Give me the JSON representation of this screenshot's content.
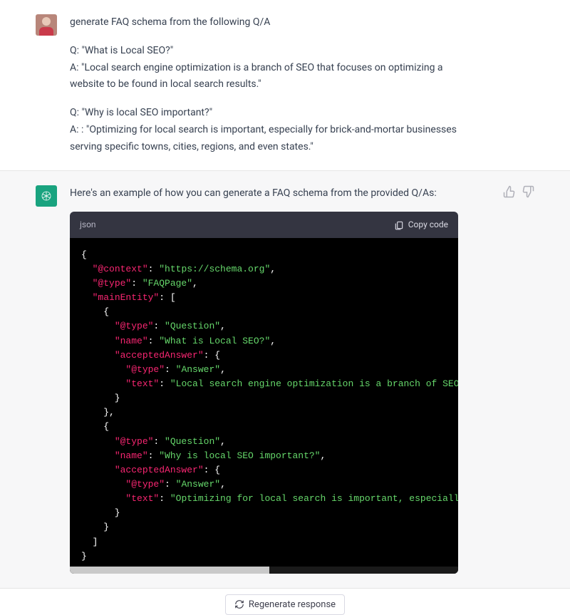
{
  "user_message": {
    "p1": "generate FAQ schema from the following Q/A",
    "p2": "Q: \"What is Local SEO?\"\nA: \"Local search engine optimization is a branch of SEO that focuses on optimizing a website to be found in local search results.\"",
    "p3": "Q: \"Why is local SEO important?\"\nA: : \"Optimizing for local search is important, especially for brick-and-mortar businesses serving specific towns, cities, regions, and even states.\""
  },
  "assistant_message": {
    "intro": "Here's an example of how you can generate a FAQ schema from the provided Q/As:"
  },
  "code": {
    "lang": "json",
    "copy_label": "Copy code",
    "tokens": {
      "t0": "{",
      "k1": "\"@context\"",
      "s1": "\"https://schema.org\"",
      "k2": "\"@type\"",
      "s2": "\"FAQPage\"",
      "k3": "\"mainEntity\"",
      "p3": ": [",
      "t4": "    {",
      "k5": "\"@type\"",
      "s5": "\"Question\"",
      "k6": "\"name\"",
      "s6": "\"What is Local SEO?\"",
      "k7": "\"acceptedAnswer\"",
      "p7": ": {",
      "k8": "\"@type\"",
      "s8": "\"Answer\"",
      "k9": "\"text\"",
      "s9": "\"Local search engine optimization is a branch of SEO that focuses o",
      "t10": "      }",
      "t11": "    },",
      "t12": "    {",
      "k13": "\"@type\"",
      "s13": "\"Question\"",
      "k14": "\"name\"",
      "s14": "\"Why is local SEO important?\"",
      "k15": "\"acceptedAnswer\"",
      "p15": ": {",
      "k16": "\"@type\"",
      "s16": "\"Answer\"",
      "k17": "\"text\"",
      "s17": "\"Optimizing for local search is important, especially for brick-and",
      "t18": "      }",
      "t19": "    }",
      "t20": "  ]",
      "t21": "}"
    }
  },
  "regen_label": "Regenerate response"
}
